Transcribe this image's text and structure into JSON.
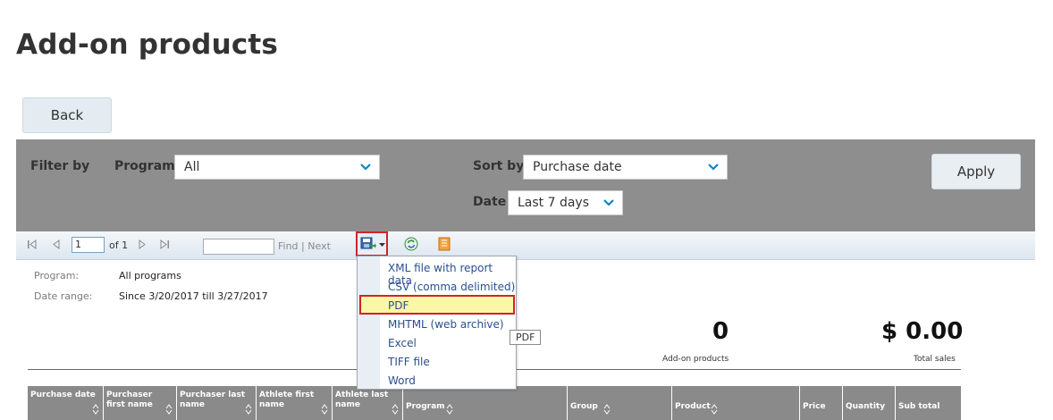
{
  "page": {
    "title": "Add-on products"
  },
  "back_button": "Back",
  "filter": {
    "filter_by_label": "Filter by",
    "program_label": "Program",
    "program_value": "All",
    "sort_by_label": "Sort by",
    "sort_value": "Purchase date",
    "date_label": "Date",
    "date_value": "Last 7 days",
    "apply_label": "Apply"
  },
  "toolbar": {
    "page_value": "1",
    "of_text": "of 1",
    "find_label": "Find",
    "separator": "|",
    "next_label": "Next"
  },
  "export_menu": {
    "items": [
      "XML file with report data",
      "CSV (comma delimited)",
      "PDF",
      "MHTML (web archive)",
      "Excel",
      "TIFF file",
      "Word"
    ],
    "tooltip": "PDF"
  },
  "report": {
    "program_label": "Program:",
    "program_value": "All programs",
    "date_range_label": "Date range:",
    "date_range_value": "Since 3/20/2017 till 3/27/2017",
    "addon_count": "0",
    "addon_caption": "Add-on products",
    "total_sales": "$ 0.00",
    "total_caption": "Total sales"
  },
  "table": {
    "headers": [
      "Purchase date",
      "Purchaser first name",
      "Purchaser last name",
      "Athlete first name",
      "Athlete last name",
      "Program",
      "Group",
      "Product",
      "Price",
      "Quantity",
      "Sub total"
    ]
  },
  "colors": {
    "accent": "#0e86c4",
    "highlight_border": "#d2232a",
    "filter_bar": "#8e8e8e"
  }
}
